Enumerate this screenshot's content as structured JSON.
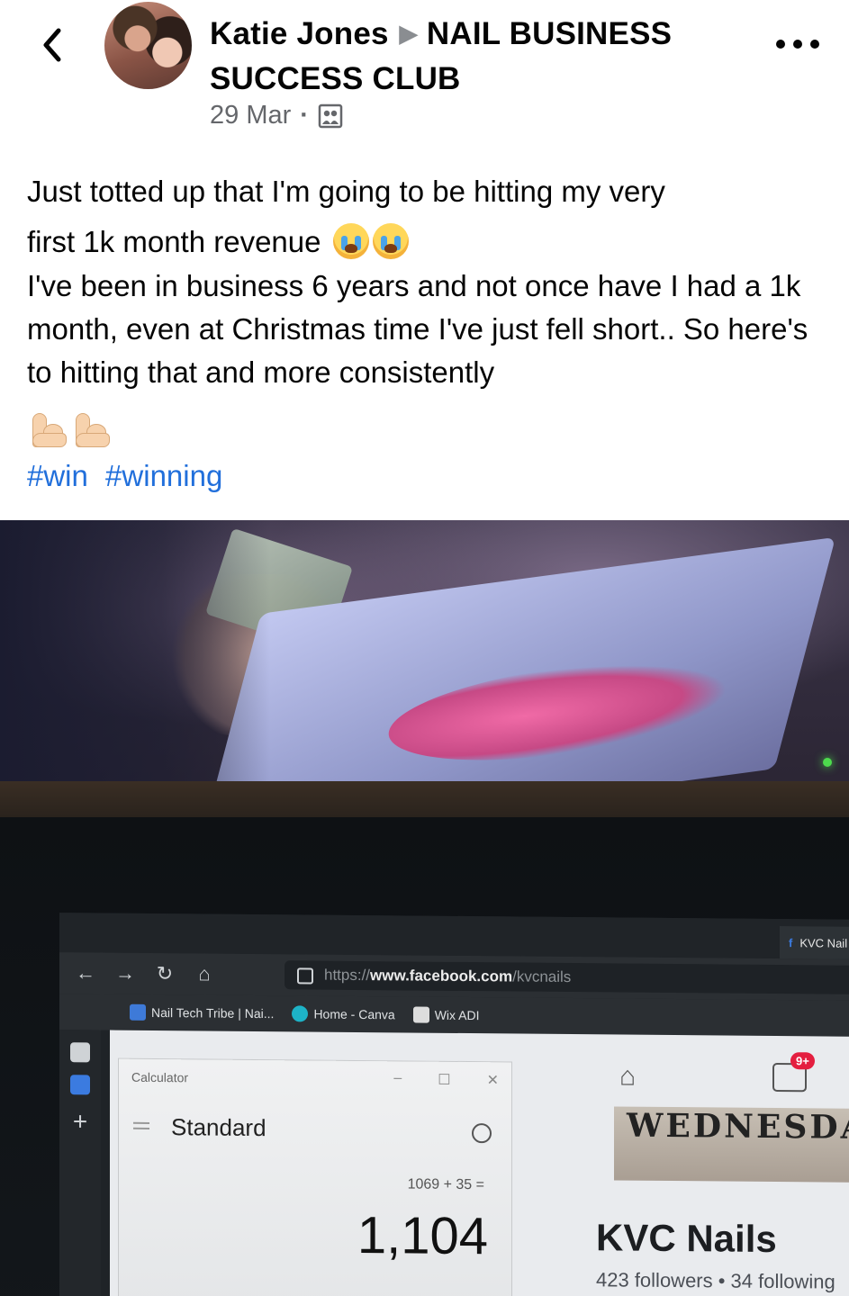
{
  "header": {
    "author": "Katie Jones",
    "group": "NAIL BUSINESS SUCCESS CLUB",
    "date": "29 Mar",
    "privacy_icon": "group-members-icon",
    "more_icon": "more-horizontal-icon",
    "back_icon": "chevron-left-icon"
  },
  "post": {
    "line1": "Just totted up that I'm going to be hitting my very",
    "line2": "first 1k month revenue",
    "paragraph2": "I've been in business 6 years and not once have I had a 1k month, even at Christmas time I've just fell short.. So here's to hitting that and more consistently",
    "hashtags": [
      "#win",
      "#winning"
    ]
  },
  "photo": {
    "browser": {
      "tab_label": "KVC Nail",
      "url_prefix": "https://",
      "url_host": "www.facebook.com",
      "url_path": "/kvcnails",
      "bookmarks": [
        "Nail Tech Tribe | Nai...",
        "Home - Canva",
        "Wix ADI"
      ]
    },
    "calculator": {
      "title": "Calculator",
      "mode": "Standard",
      "expression": "1069 + 35 =",
      "result": "1,104"
    },
    "facebook_page": {
      "notification_badge": "9+",
      "cover_text": "WEDNESDA",
      "name": "KVC Nails",
      "followers": "423 followers • 34 following"
    }
  },
  "colors": {
    "link": "#216fdb",
    "meta": "#65676b",
    "text": "#050505"
  }
}
